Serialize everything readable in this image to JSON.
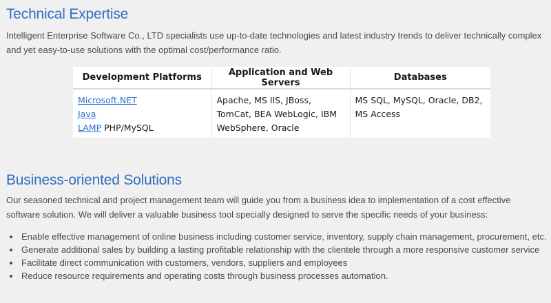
{
  "technical": {
    "heading": "Technical Expertise",
    "intro": "Intelligent Enterprise Software Co., LTD specialists use up-to-date technologies and latest industry trends to deliver technically complex and yet easy-to-use solutions with the optimal cost/performance ratio.",
    "table": {
      "headers": [
        "Development Platforms",
        "Application and Web Servers",
        "Databases"
      ],
      "platforms": [
        {
          "link": "Microsoft.NET",
          "suffix": ""
        },
        {
          "link": "Java",
          "suffix": ""
        },
        {
          "link": "LAMP",
          "suffix": " PHP/MySQL"
        }
      ],
      "servers": "Apache, MS IIS, JBoss, TomCat, BEA WebLogic, IBM WebSphere, Oracle",
      "databases": "MS SQL, MySQL, Oracle, DB2, MS Access"
    }
  },
  "business": {
    "heading": "Business-oriented Solutions",
    "intro": "Our seasoned technical and project management team will guide you from a business idea to implementation of a cost effective software solution. We will deliver a valuable business tool specially designed to serve the specific needs of your business:",
    "bullets": [
      "Enable effective management of online business including customer service, inventory, supply chain management, procurement, etc.",
      "Generate additional sales by building a lasting profitable relationship with the clientele through a more responsive customer service",
      "Facilitate direct communication with customers, vendors, suppliers and employees",
      "Reduce resource requirements and operating costs through business processes automation."
    ]
  }
}
